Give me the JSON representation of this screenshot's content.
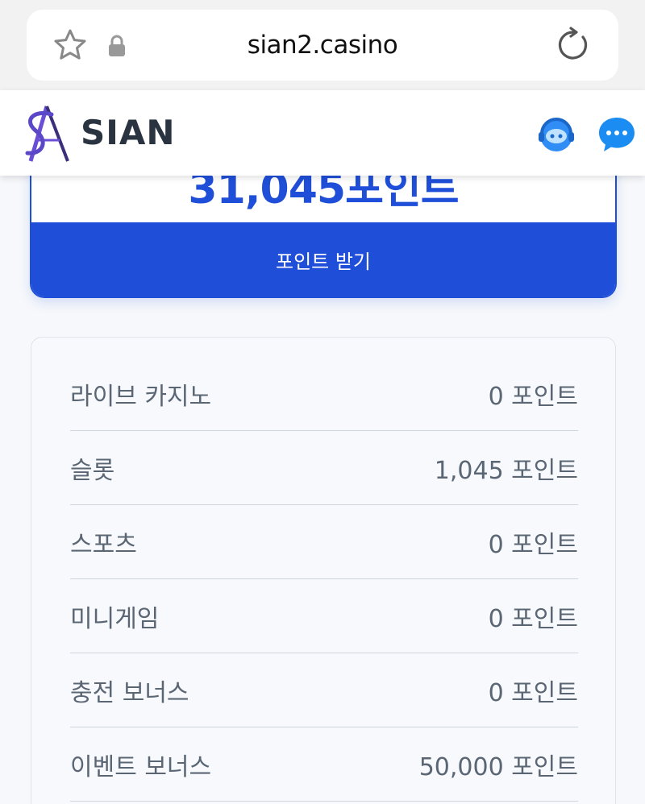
{
  "browser": {
    "url": "sian2.casino",
    "icons": [
      "star-icon",
      "lock-icon",
      "reload-icon"
    ]
  },
  "header": {
    "logo_text": "SIAN",
    "icons": [
      "support-agent-icon",
      "chat-bubble-icon"
    ],
    "colors": {
      "logo_primary": "#6a4fd6",
      "logo_text": "#2a3440",
      "chat": "#1b8cf2"
    }
  },
  "points": {
    "total": "31,045포인트",
    "claim_label": "포인트 받기",
    "accent_color": "#1f4fd8"
  },
  "breakdown": [
    {
      "label": "라이브 카지노",
      "value": "0 포인트"
    },
    {
      "label": "슬롯",
      "value": "1,045 포인트"
    },
    {
      "label": "스포츠",
      "value": "0 포인트"
    },
    {
      "label": "미니게임",
      "value": "0 포인트"
    },
    {
      "label": "충전 보너스",
      "value": "0 포인트"
    },
    {
      "label": "이벤트 보너스",
      "value": "50,000 포인트"
    }
  ]
}
